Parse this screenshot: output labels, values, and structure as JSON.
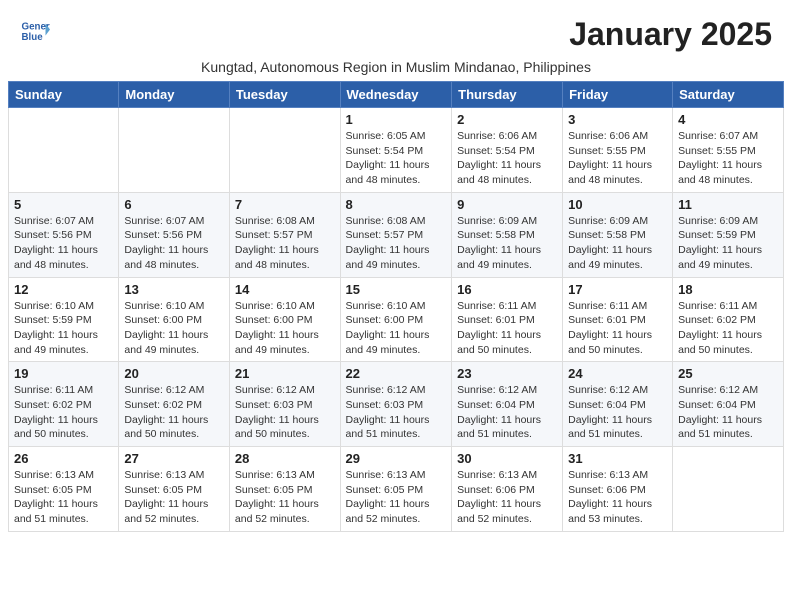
{
  "logo": {
    "line1": "General",
    "line2": "Blue"
  },
  "title": "January 2025",
  "subtitle": "Kungtad, Autonomous Region in Muslim Mindanao, Philippines",
  "days_header": [
    "Sunday",
    "Monday",
    "Tuesday",
    "Wednesday",
    "Thursday",
    "Friday",
    "Saturday"
  ],
  "weeks": [
    [
      {
        "num": "",
        "info": ""
      },
      {
        "num": "",
        "info": ""
      },
      {
        "num": "",
        "info": ""
      },
      {
        "num": "1",
        "info": "Sunrise: 6:05 AM\nSunset: 5:54 PM\nDaylight: 11 hours\nand 48 minutes."
      },
      {
        "num": "2",
        "info": "Sunrise: 6:06 AM\nSunset: 5:54 PM\nDaylight: 11 hours\nand 48 minutes."
      },
      {
        "num": "3",
        "info": "Sunrise: 6:06 AM\nSunset: 5:55 PM\nDaylight: 11 hours\nand 48 minutes."
      },
      {
        "num": "4",
        "info": "Sunrise: 6:07 AM\nSunset: 5:55 PM\nDaylight: 11 hours\nand 48 minutes."
      }
    ],
    [
      {
        "num": "5",
        "info": "Sunrise: 6:07 AM\nSunset: 5:56 PM\nDaylight: 11 hours\nand 48 minutes."
      },
      {
        "num": "6",
        "info": "Sunrise: 6:07 AM\nSunset: 5:56 PM\nDaylight: 11 hours\nand 48 minutes."
      },
      {
        "num": "7",
        "info": "Sunrise: 6:08 AM\nSunset: 5:57 PM\nDaylight: 11 hours\nand 48 minutes."
      },
      {
        "num": "8",
        "info": "Sunrise: 6:08 AM\nSunset: 5:57 PM\nDaylight: 11 hours\nand 49 minutes."
      },
      {
        "num": "9",
        "info": "Sunrise: 6:09 AM\nSunset: 5:58 PM\nDaylight: 11 hours\nand 49 minutes."
      },
      {
        "num": "10",
        "info": "Sunrise: 6:09 AM\nSunset: 5:58 PM\nDaylight: 11 hours\nand 49 minutes."
      },
      {
        "num": "11",
        "info": "Sunrise: 6:09 AM\nSunset: 5:59 PM\nDaylight: 11 hours\nand 49 minutes."
      }
    ],
    [
      {
        "num": "12",
        "info": "Sunrise: 6:10 AM\nSunset: 5:59 PM\nDaylight: 11 hours\nand 49 minutes."
      },
      {
        "num": "13",
        "info": "Sunrise: 6:10 AM\nSunset: 6:00 PM\nDaylight: 11 hours\nand 49 minutes."
      },
      {
        "num": "14",
        "info": "Sunrise: 6:10 AM\nSunset: 6:00 PM\nDaylight: 11 hours\nand 49 minutes."
      },
      {
        "num": "15",
        "info": "Sunrise: 6:10 AM\nSunset: 6:00 PM\nDaylight: 11 hours\nand 49 minutes."
      },
      {
        "num": "16",
        "info": "Sunrise: 6:11 AM\nSunset: 6:01 PM\nDaylight: 11 hours\nand 50 minutes."
      },
      {
        "num": "17",
        "info": "Sunrise: 6:11 AM\nSunset: 6:01 PM\nDaylight: 11 hours\nand 50 minutes."
      },
      {
        "num": "18",
        "info": "Sunrise: 6:11 AM\nSunset: 6:02 PM\nDaylight: 11 hours\nand 50 minutes."
      }
    ],
    [
      {
        "num": "19",
        "info": "Sunrise: 6:11 AM\nSunset: 6:02 PM\nDaylight: 11 hours\nand 50 minutes."
      },
      {
        "num": "20",
        "info": "Sunrise: 6:12 AM\nSunset: 6:02 PM\nDaylight: 11 hours\nand 50 minutes."
      },
      {
        "num": "21",
        "info": "Sunrise: 6:12 AM\nSunset: 6:03 PM\nDaylight: 11 hours\nand 50 minutes."
      },
      {
        "num": "22",
        "info": "Sunrise: 6:12 AM\nSunset: 6:03 PM\nDaylight: 11 hours\nand 51 minutes."
      },
      {
        "num": "23",
        "info": "Sunrise: 6:12 AM\nSunset: 6:04 PM\nDaylight: 11 hours\nand 51 minutes."
      },
      {
        "num": "24",
        "info": "Sunrise: 6:12 AM\nSunset: 6:04 PM\nDaylight: 11 hours\nand 51 minutes."
      },
      {
        "num": "25",
        "info": "Sunrise: 6:12 AM\nSunset: 6:04 PM\nDaylight: 11 hours\nand 51 minutes."
      }
    ],
    [
      {
        "num": "26",
        "info": "Sunrise: 6:13 AM\nSunset: 6:05 PM\nDaylight: 11 hours\nand 51 minutes."
      },
      {
        "num": "27",
        "info": "Sunrise: 6:13 AM\nSunset: 6:05 PM\nDaylight: 11 hours\nand 52 minutes."
      },
      {
        "num": "28",
        "info": "Sunrise: 6:13 AM\nSunset: 6:05 PM\nDaylight: 11 hours\nand 52 minutes."
      },
      {
        "num": "29",
        "info": "Sunrise: 6:13 AM\nSunset: 6:05 PM\nDaylight: 11 hours\nand 52 minutes."
      },
      {
        "num": "30",
        "info": "Sunrise: 6:13 AM\nSunset: 6:06 PM\nDaylight: 11 hours\nand 52 minutes."
      },
      {
        "num": "31",
        "info": "Sunrise: 6:13 AM\nSunset: 6:06 PM\nDaylight: 11 hours\nand 53 minutes."
      },
      {
        "num": "",
        "info": ""
      }
    ]
  ]
}
